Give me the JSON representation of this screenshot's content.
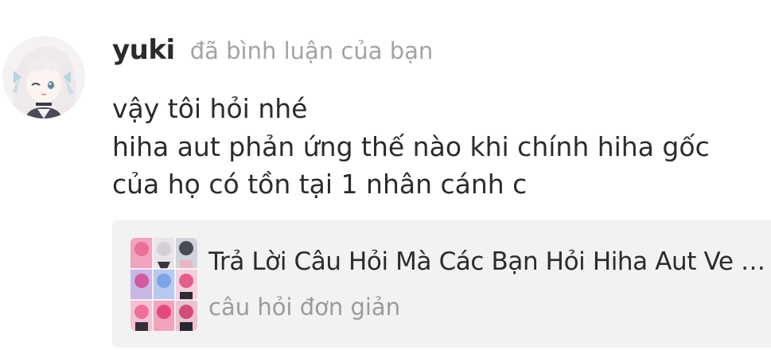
{
  "notification": {
    "username": "yuki",
    "action": "đã bình luận của bạn",
    "comment_lines": [
      "vậy tôi hỏi nhé",
      "hiha aut phản ứng thế nào khi chính hiha gốc",
      "của họ có tồn tại 1 nhân cánh c"
    ]
  },
  "story_card": {
    "title": "Trả Lời Câu Hỏi Mà Các Bạn Hỏi Hiha Aut Ve Hiha Gốc",
    "subtitle": "câu hỏi đơn giản"
  },
  "colors": {
    "text": "#2b2b2b",
    "muted": "#a3a3a3",
    "card_background": "#f2f2f2"
  },
  "icons": {
    "avatar": "anime-avatar-image",
    "cover": "story-cover-collage"
  }
}
